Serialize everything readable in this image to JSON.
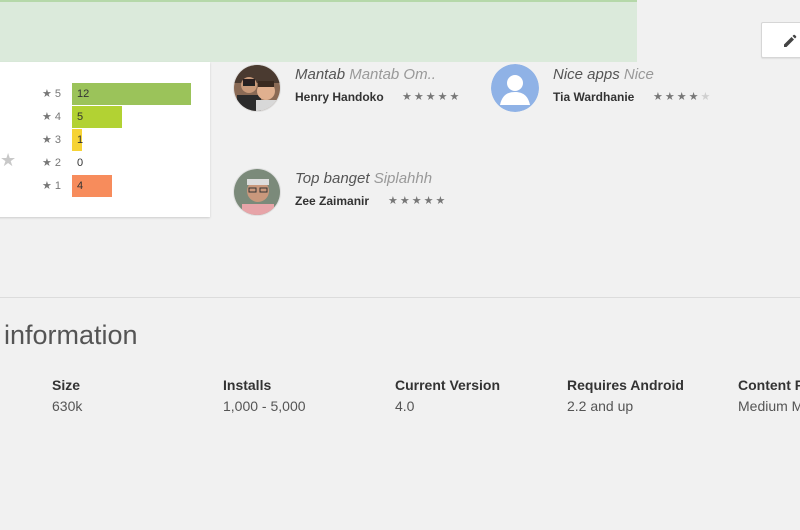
{
  "ratings": {
    "max_count": 12,
    "rows": [
      {
        "stars": "5",
        "count": "12",
        "color": "#9bc35a"
      },
      {
        "stars": "4",
        "count": "5",
        "color": "#b2d233"
      },
      {
        "stars": "3",
        "count": "1",
        "color": "#f6d335"
      },
      {
        "stars": "2",
        "count": "0",
        "color": "#f9b24c"
      },
      {
        "stars": "1",
        "count": "4",
        "color": "#f78c5c"
      }
    ]
  },
  "reviews": [
    {
      "title": "Mantab",
      "body": "Mantab Om..",
      "author": "Henry Handoko",
      "stars": 5,
      "avatar": "photo-father-and-child"
    },
    {
      "title": "Nice apps",
      "body": "Nice",
      "author": "Tia Wardhanie",
      "stars": 4,
      "avatar": "default-person-icon"
    },
    {
      "title": "Top banget",
      "body": "Siplahhh",
      "author": "Zee Zaimanir",
      "stars": 5,
      "avatar": "photo-man-with-glasses"
    }
  ],
  "additional_info": {
    "title": "information",
    "items": [
      {
        "label": "Size",
        "value": "630k"
      },
      {
        "label": "Installs",
        "value": "1,000 - 5,000"
      },
      {
        "label": "Current Version",
        "value": "4.0"
      },
      {
        "label": "Requires Android",
        "value": "2.2 and up"
      },
      {
        "label": "Content R",
        "value": "Medium M"
      }
    ]
  },
  "toolbar": {
    "edit_icon": "pencil-icon"
  },
  "colors": {
    "banner": "#dbeadb",
    "background": "#f1f1f1",
    "card": "#ffffff"
  }
}
